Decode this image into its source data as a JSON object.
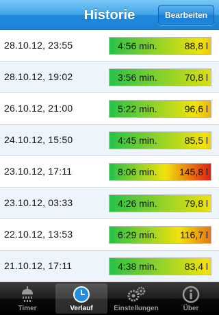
{
  "header": {
    "title": "Historie",
    "edit_label": "Bearbeiten"
  },
  "entries": [
    {
      "date": "28.10.12, 23:55",
      "duration": "4:56 min.",
      "volume": "88,8 l",
      "level": 0.61
    },
    {
      "date": "28.10.12, 19:02",
      "duration": "3:56 min.",
      "volume": "70,8 l",
      "level": 0.49
    },
    {
      "date": "26.10.12, 21:00",
      "duration": "5:22 min.",
      "volume": "96,6 l",
      "level": 0.66
    },
    {
      "date": "24.10.12, 15:50",
      "duration": "4:45 min.",
      "volume": "85,5 l",
      "level": 0.59
    },
    {
      "date": "23.10.12, 17:11",
      "duration": "8:06 min.",
      "volume": "145,8 l",
      "level": 1.0
    },
    {
      "date": "23.10.12, 03:33",
      "duration": "4:26 min.",
      "volume": "79,8 l",
      "level": 0.55
    },
    {
      "date": "22.10.12, 13:53",
      "duration": "6:29 min.",
      "volume": "116,7 l",
      "level": 0.8
    },
    {
      "date": "21.10.12, 17:11",
      "duration": "4:38 min.",
      "volume": "83,4 l",
      "level": 0.57
    }
  ],
  "tabs": [
    {
      "key": "timer",
      "label": "Timer",
      "icon": "shower-icon",
      "active": false
    },
    {
      "key": "verlauf",
      "label": "Verlauf",
      "icon": "clock-icon",
      "active": true
    },
    {
      "key": "einstellungen",
      "label": "Einstellungen",
      "icon": "gears-icon",
      "active": false
    },
    {
      "key": "ueber",
      "label": "Über",
      "icon": "info-icon",
      "active": false
    }
  ],
  "colors": {
    "accent_green": "#2ac247",
    "mid_yellow": "#f1e20c",
    "high_red": "#e02010",
    "nav_blue": "#1f8bdc"
  }
}
